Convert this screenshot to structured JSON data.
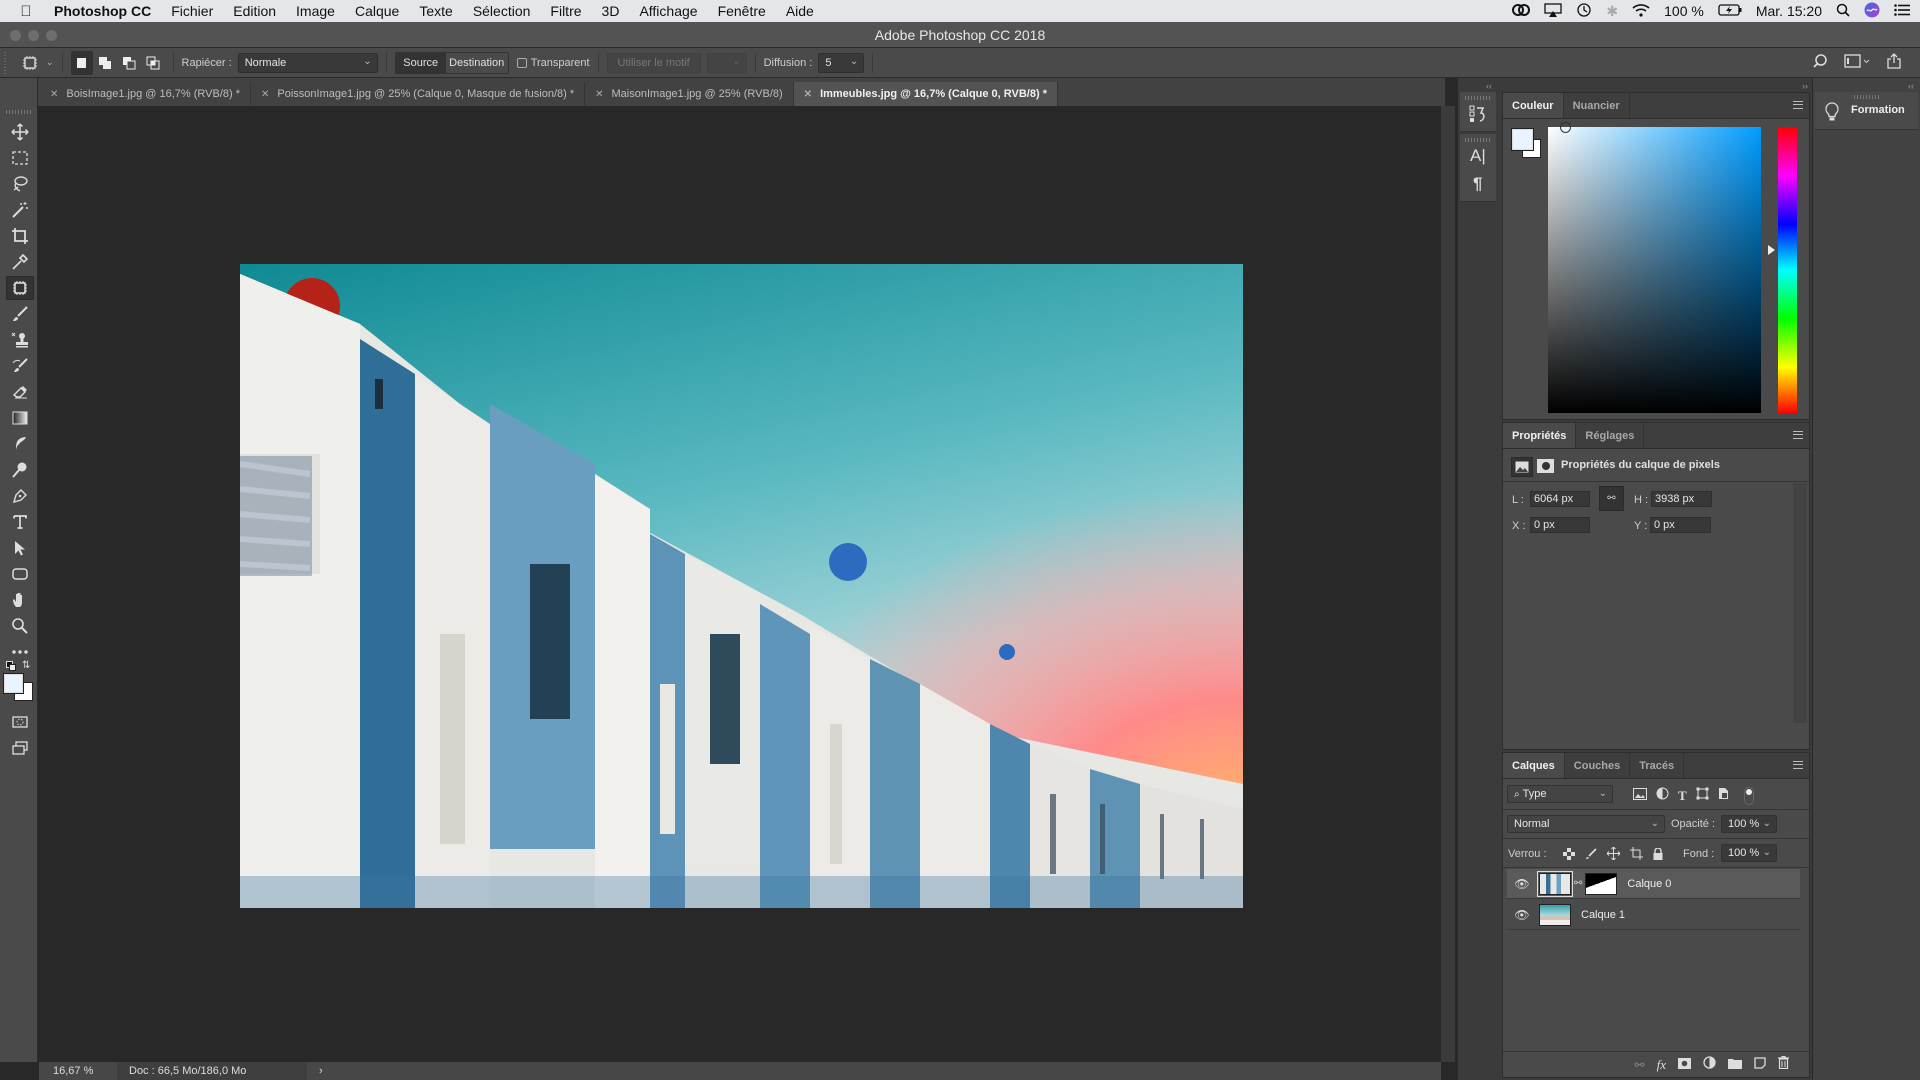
{
  "menubar": {
    "apple_icon": "apple-icon",
    "app_name": "Photoshop CC",
    "items": [
      "Fichier",
      "Edition",
      "Image",
      "Calque",
      "Texte",
      "Sélection",
      "Filtre",
      "3D",
      "Affichage",
      "Fenêtre",
      "Aide"
    ],
    "status": {
      "battery": "100 %",
      "clock": "Mar. 15:20",
      "icons": [
        "creative-cloud-icon",
        "airplay-icon",
        "time-machine-icon",
        "bluetooth-icon",
        "wifi-icon",
        "battery-icon",
        "spotlight-icon",
        "siri-icon",
        "notification-center-icon"
      ]
    }
  },
  "window": {
    "title": "Adobe Photoshop CC 2018"
  },
  "options": {
    "tool_icon": "patch-tool-icon",
    "mode_icons": [
      "new-selection-icon",
      "add-selection-icon",
      "subtract-selection-icon",
      "intersect-selection-icon"
    ],
    "patch_label": "Rapiécer :",
    "patch_value": "Normale",
    "source_label": "Source",
    "destination_label": "Destination",
    "transparent_label": "Transparent",
    "transparent_checked": false,
    "use_pattern_label": "Utiliser le motif",
    "diffusion_label": "Diffusion :",
    "diffusion_value": "5",
    "right_icons": [
      "search-icon",
      "workspace-icon",
      "share-icon"
    ]
  },
  "tabs": [
    {
      "label": "BoisImage1.jpg @ 16,7% (RVB/8) *",
      "active": false
    },
    {
      "label": "PoissonImage1.jpg @ 25% (Calque 0, Masque de fusion/8) *",
      "active": false
    },
    {
      "label": "MaisonImage1.jpg @ 25% (RVB/8)",
      "active": false
    },
    {
      "label": "Immeubles.jpg @ 16,7% (Calque 0, RVB/8) *",
      "active": true
    }
  ],
  "tools": [
    "move-tool",
    "marquee-tool",
    "lasso-tool",
    "magic-wand-tool",
    "crop-tool",
    "eyedropper-tool",
    "patch-tool",
    "brush-tool",
    "clone-stamp-tool",
    "history-brush-tool",
    "eraser-tool",
    "gradient-tool",
    "smudge-tool",
    "dodge-tool",
    "pen-tool",
    "type-tool",
    "path-selection-tool",
    "rectangle-tool",
    "hand-tool",
    "zoom-tool",
    "more-tools"
  ],
  "selected_tool": "patch-tool",
  "status": {
    "zoom": "16,67 %",
    "doc": "Doc : 66,5 Mo/186,0 Mo",
    "arrow": "›"
  },
  "color_panel": {
    "tabs": [
      "Couleur",
      "Nuancier"
    ],
    "active_tab": "Couleur",
    "foreground": "#e8f4ff",
    "background": "#ffffff",
    "hue_color": "#009cff"
  },
  "properties_panel": {
    "tabs": [
      "Propriétés",
      "Réglages"
    ],
    "active_tab": "Propriétés",
    "heading": "Propriétés du calque de pixels",
    "w_label": "L :",
    "w_value": "6064 px",
    "h_label": "H :",
    "h_value": "3938 px",
    "x_label": "X :",
    "x_value": "0 px",
    "y_label": "Y :",
    "y_value": "0 px"
  },
  "layers_panel": {
    "tabs": [
      "Calques",
      "Couches",
      "Tracés"
    ],
    "active_tab": "Calques",
    "filter_label": "Type",
    "blend_mode": "Normal",
    "opacity_label": "Opacité :",
    "opacity_value": "100 %",
    "lock_label": "Verrou :",
    "fill_label": "Fond :",
    "fill_value": "100 %",
    "layers": [
      {
        "name": "Calque 0",
        "visible": true,
        "selected": true,
        "has_mask": true
      },
      {
        "name": "Calque 1",
        "visible": true,
        "selected": false,
        "has_mask": false
      }
    ],
    "footer_icons": [
      "link-layers-icon",
      "fx-icon",
      "add-mask-icon",
      "adjustment-layer-icon",
      "new-group-icon",
      "new-layer-icon",
      "trash-icon"
    ]
  },
  "formation_panel": {
    "label": "Formation"
  }
}
